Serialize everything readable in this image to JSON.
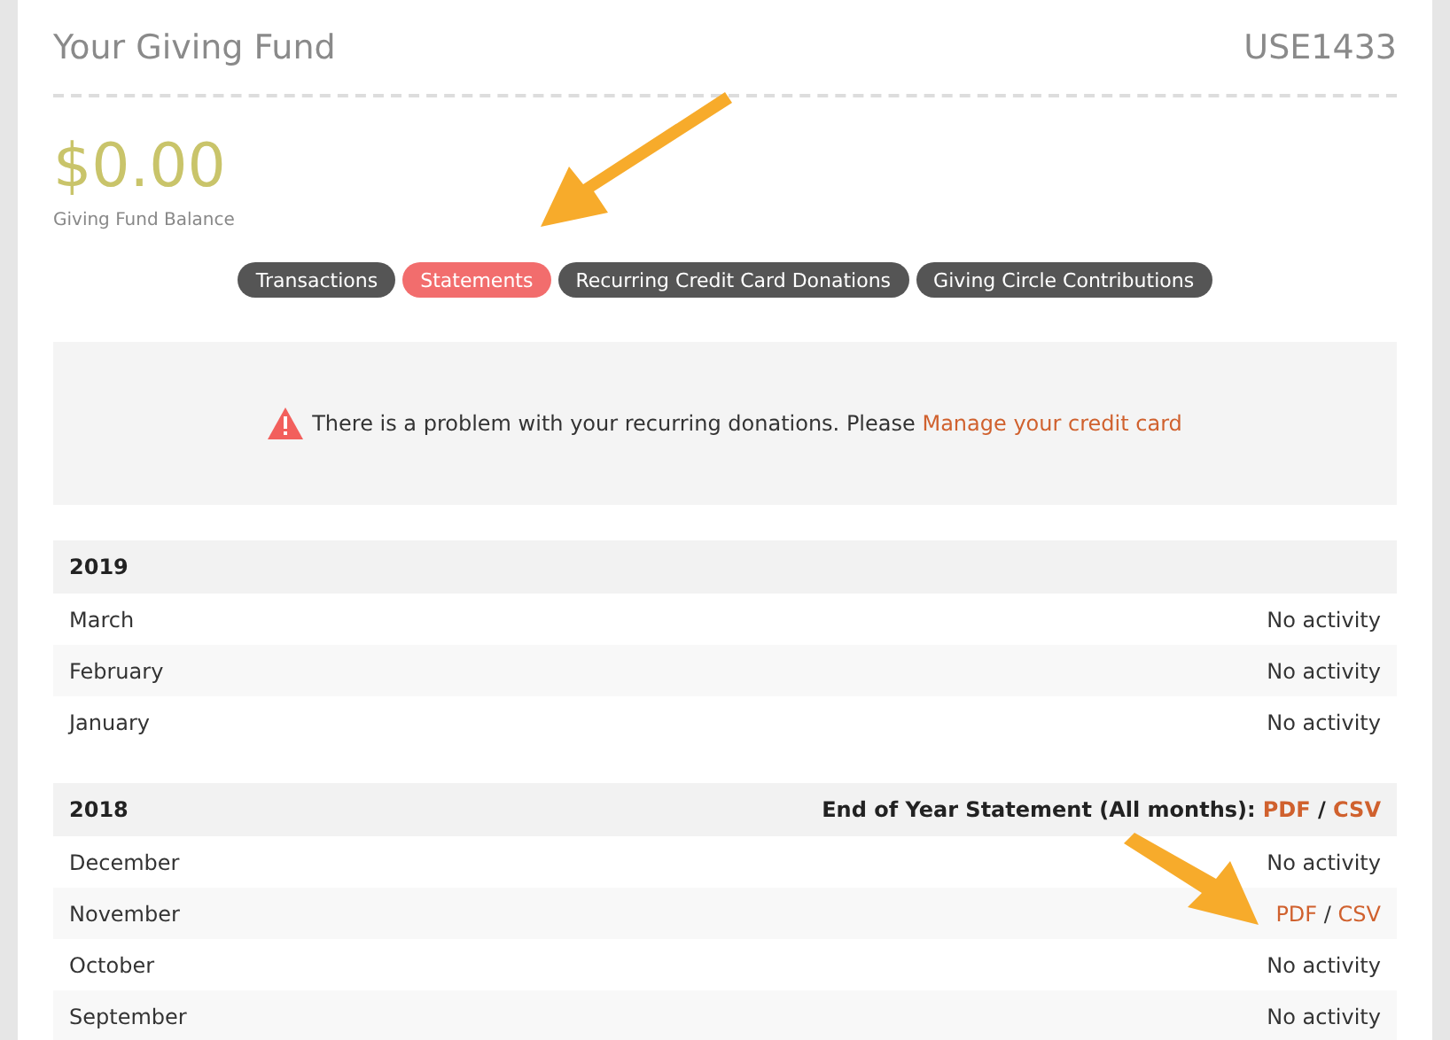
{
  "header": {
    "title": "Your Giving Fund",
    "account_id": "USE1433"
  },
  "balance": {
    "amount": "$0.00",
    "label": "Giving Fund Balance"
  },
  "tabs": [
    {
      "label": "Transactions",
      "selected": false
    },
    {
      "label": "Statements",
      "selected": true
    },
    {
      "label": "Recurring Credit Card Donations",
      "selected": false
    },
    {
      "label": "Giving Circle Contributions",
      "selected": false
    }
  ],
  "alert": {
    "message": "There is a problem with your recurring donations. Please",
    "link": "Manage your credit card"
  },
  "years": [
    {
      "year": "2019",
      "months": [
        {
          "name": "March",
          "kind": "none",
          "status": "No activity"
        },
        {
          "name": "February",
          "kind": "none",
          "status": "No activity"
        },
        {
          "name": "January",
          "kind": "none",
          "status": "No activity"
        }
      ]
    },
    {
      "year": "2018",
      "end_of_year": {
        "label": "End of Year Statement (All months):",
        "pdf": "PDF",
        "separator": "/",
        "csv": "CSV"
      },
      "months": [
        {
          "name": "December",
          "kind": "none",
          "status": "No activity"
        },
        {
          "name": "November",
          "kind": "links",
          "pdf": "PDF",
          "separator": "/",
          "csv": "CSV"
        },
        {
          "name": "October",
          "kind": "none",
          "status": "No activity"
        },
        {
          "name": "September",
          "kind": "none",
          "status": "No activity"
        }
      ]
    }
  ]
}
